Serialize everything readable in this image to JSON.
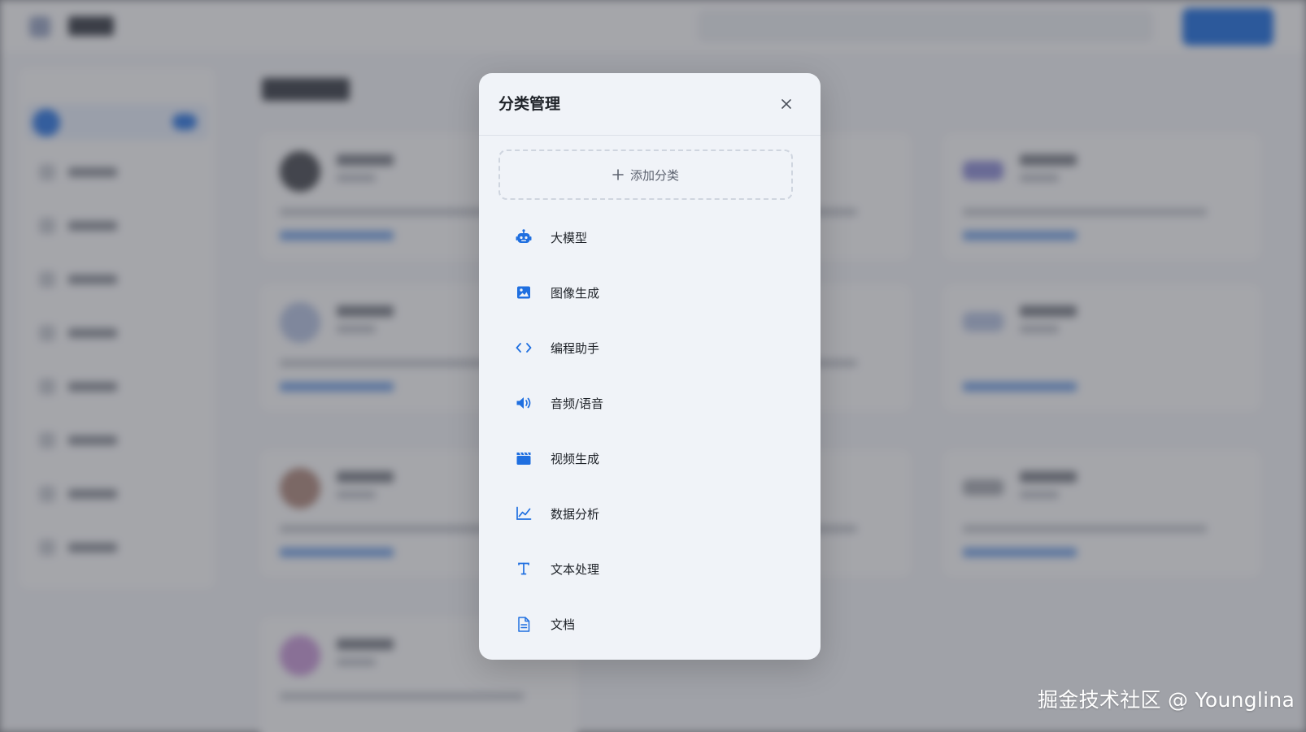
{
  "modal": {
    "title": "分类管理",
    "add_label": "添加分类",
    "categories": [
      {
        "label": "大模型",
        "icon": "robot-icon"
      },
      {
        "label": "图像生成",
        "icon": "image-icon"
      },
      {
        "label": "编程助手",
        "icon": "code-icon"
      },
      {
        "label": "音频/语音",
        "icon": "volume-icon"
      },
      {
        "label": "视频生成",
        "icon": "clapperboard-icon"
      },
      {
        "label": "数据分析",
        "icon": "line-chart-icon"
      },
      {
        "label": "文本处理",
        "icon": "text-icon"
      },
      {
        "label": "文档",
        "icon": "document-icon"
      }
    ]
  },
  "colors": {
    "accent": "#1f6fe0",
    "modal_bg": "#f0f3f8",
    "text": "#1f2329"
  },
  "watermark": "掘金技术社区 @ Younglina"
}
